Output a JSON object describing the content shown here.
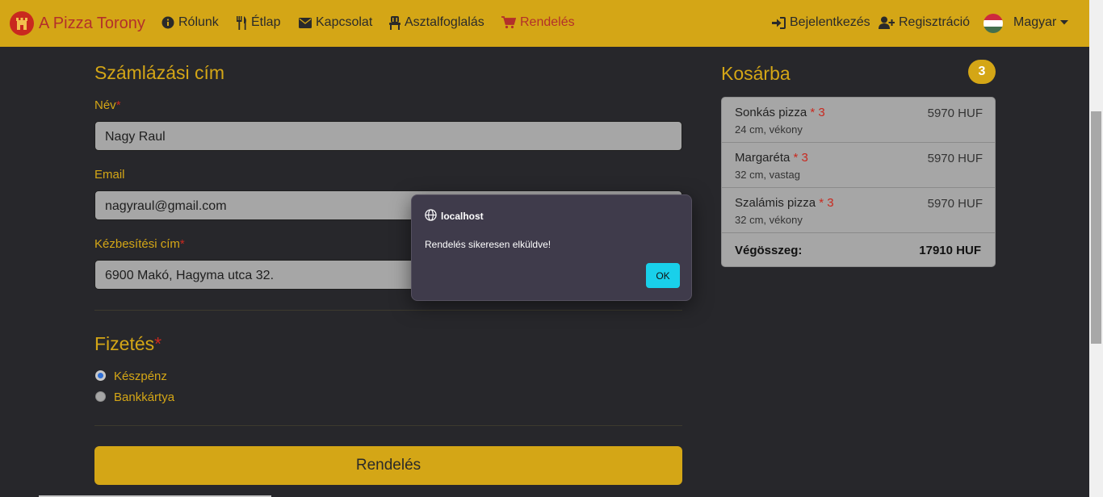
{
  "navbar": {
    "brand": "A Pizza Torony",
    "links": [
      {
        "label": "Rólunk",
        "icon": "info-icon"
      },
      {
        "label": "Étlap",
        "icon": "utensils-icon"
      },
      {
        "label": "Kapcsolat",
        "icon": "envelope-icon"
      },
      {
        "label": "Asztalfoglalás",
        "icon": "chair-icon"
      },
      {
        "label": "Rendelés",
        "icon": "cart-icon"
      }
    ],
    "login": "Bejelentkezés",
    "register": "Regisztráció",
    "language": "Magyar"
  },
  "billing": {
    "title": "Számlázási cím",
    "name_label": "Név",
    "name_value": "Nagy Raul",
    "email_label": "Email",
    "email_value": "nagyraul@gmail.com",
    "address_label": "Kézbesítési cím",
    "address_value": "6900 Makó, Hagyma utca 32.",
    "required_mark": "*"
  },
  "payment": {
    "title": "Fizetés",
    "options": [
      "Készpénz",
      "Bankkártya"
    ],
    "selected": "Készpénz"
  },
  "submit_label": "Rendelés",
  "cart": {
    "title": "Kosárba",
    "count": "3",
    "items": [
      {
        "name": "Sonkás pizza",
        "qty": "* 3",
        "details": "24 cm, vékony",
        "price": "5970 HUF"
      },
      {
        "name": "Margaréta",
        "qty": "* 3",
        "details": "32 cm, vastag",
        "price": "5970 HUF"
      },
      {
        "name": "Szalámis pizza",
        "qty": "* 3",
        "details": "32 cm, vékony",
        "price": "5970 HUF"
      }
    ],
    "total_label": "Végösszeg:",
    "total_value": "17910 HUF"
  },
  "dialog": {
    "host": "localhost",
    "message": "Rendelés sikeresen elküldve!",
    "ok_label": "OK"
  },
  "colors": {
    "accent": "#d4a616",
    "brand_red": "#b3302a",
    "background": "#27272b",
    "dialog_button": "#19d0ea"
  }
}
